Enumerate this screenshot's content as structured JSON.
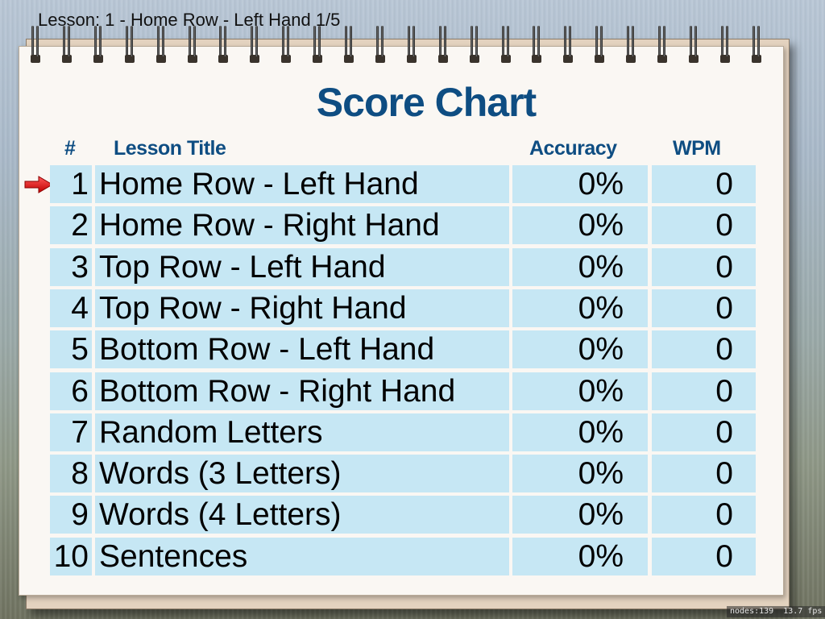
{
  "lesson_label": "Lesson: 1 - Home Row - Left Hand 1/5",
  "title": "Score Chart",
  "headers": {
    "number": "#",
    "lesson_title": "Lesson Title",
    "accuracy": "Accuracy",
    "wpm": "WPM"
  },
  "current_lesson_indicator": "arrow-right-icon",
  "rows": [
    {
      "num": "1",
      "title": "Home Row - Left Hand",
      "accuracy": "0%",
      "wpm": "0"
    },
    {
      "num": "2",
      "title": "Home Row - Right Hand",
      "accuracy": "0%",
      "wpm": "0"
    },
    {
      "num": "3",
      "title": "Top Row - Left Hand",
      "accuracy": "0%",
      "wpm": "0"
    },
    {
      "num": "4",
      "title": "Top Row - Right Hand",
      "accuracy": "0%",
      "wpm": "0"
    },
    {
      "num": "5",
      "title": "Bottom Row - Left Hand",
      "accuracy": "0%",
      "wpm": "0"
    },
    {
      "num": "6",
      "title": "Bottom Row - Right Hand",
      "accuracy": "0%",
      "wpm": "0"
    },
    {
      "num": "7",
      "title": "Random Letters",
      "accuracy": "0%",
      "wpm": "0"
    },
    {
      "num": "8",
      "title": "Words (3 Letters)",
      "accuracy": "0%",
      "wpm": "0"
    },
    {
      "num": "9",
      "title": "Words (4 Letters)",
      "accuracy": "0%",
      "wpm": "0"
    },
    {
      "num": "10",
      "title": "Sentences",
      "accuracy": "0%",
      "wpm": "0"
    }
  ],
  "debug": {
    "nodes": "nodes:139",
    "fps": "13.7 fps"
  },
  "colors": {
    "title": "#0e4d82",
    "cell": "#c6e7f4",
    "arrow": "#e01010"
  }
}
